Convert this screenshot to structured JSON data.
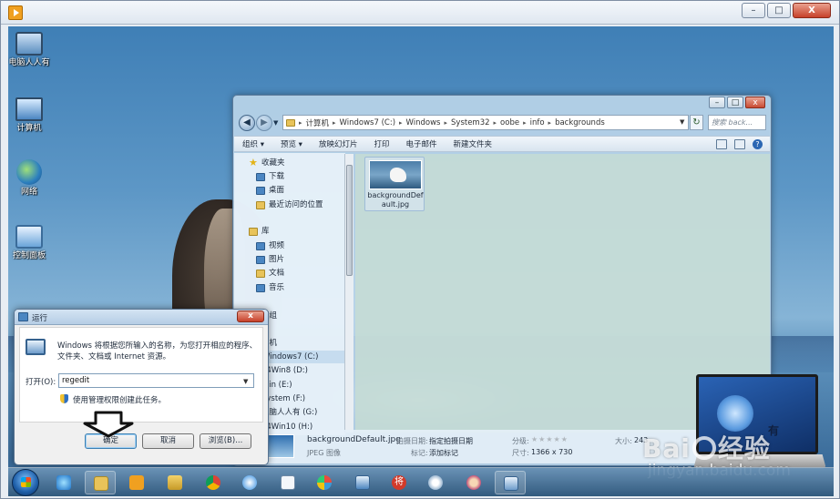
{
  "desktop": {
    "icons": [
      {
        "label": "电脑人人有"
      },
      {
        "label": "计算机"
      },
      {
        "label": "网络"
      },
      {
        "label": "控制面板"
      }
    ]
  },
  "explorer": {
    "address": [
      "计算机",
      "Windows7 (C:)",
      "Windows",
      "System32",
      "oobe",
      "info",
      "backgrounds"
    ],
    "search_placeholder": "搜索 back...",
    "toolbar": [
      "组织 ▾",
      "预览 ▾",
      "放映幻灯片",
      "打印",
      "电子邮件",
      "新建文件夹"
    ],
    "nav": {
      "favorites_header": "收藏夹",
      "favorites": [
        "下载",
        "桌面",
        "最近访问的位置"
      ],
      "libraries_header": "库",
      "libraries": [
        "视频",
        "图片",
        "文档",
        "音乐"
      ],
      "homegroup_partial": "庭组",
      "computer_partial": "算机",
      "drives": [
        "Windows7 (C:)",
        "n4Win8  (D:)",
        "Win (E:)",
        "System (F:)",
        "电脑人人有 (G:)",
        "n4Win10 (H:)"
      ]
    },
    "files": [
      {
        "name": "backgroundDefault.jpg"
      }
    ],
    "details": {
      "filename": "backgroundDefault.jpg",
      "type": "JPEG 图像",
      "date_label": "拍摄日期:",
      "date_value": "指定拍摄日期",
      "tags_label": "标记:",
      "tags_value": "添加标记",
      "rating_label": "分级:",
      "rating_stars": "★★★★★",
      "size_dims_label": "尺寸:",
      "size_dims_value": "1366 x 730",
      "size_label": "大小:",
      "size_value": "243"
    }
  },
  "run_dialog": {
    "title": "运行",
    "close": "x",
    "description": "Windows 将根据您所输入的名称，为您打开相应的程序、文件夹、文档或 Internet 资源。",
    "open_label": "打开(O):",
    "input_value": "regedit",
    "admin_note": "使用管理权限创建此任务。",
    "ok": "确定",
    "cancel": "取消",
    "browse": "浏览(B)..."
  },
  "player": {
    "min": "–",
    "max": "□",
    "close": "X"
  },
  "watermark": {
    "brand": "Bai",
    "brand_tail": "经验",
    "url": "jingyan.baidu.com",
    "laptop_text": "有"
  },
  "taskbar": {
    "apps": [
      {
        "icon": "ie-icon",
        "open": false
      },
      {
        "icon": "explorer-icon",
        "open": true
      },
      {
        "icon": "media-player-icon",
        "open": false
      },
      {
        "icon": "folder-icon",
        "open": false
      },
      {
        "icon": "chrome-icon",
        "open": false
      },
      {
        "icon": "qq-browser-icon",
        "open": false
      },
      {
        "icon": "document-icon",
        "open": false
      },
      {
        "icon": "paint-icon",
        "open": false
      },
      {
        "icon": "remote-desktop-icon",
        "open": false
      },
      {
        "icon": "chess-icon",
        "open": false
      },
      {
        "icon": "settings-flower-icon",
        "open": false
      },
      {
        "icon": "monkey-icon",
        "open": false
      },
      {
        "icon": "run-icon",
        "open": true
      }
    ]
  },
  "colors": {
    "accent": "#3c7fb1",
    "close_red": "#c7412a",
    "selection": "#c6dcef"
  }
}
